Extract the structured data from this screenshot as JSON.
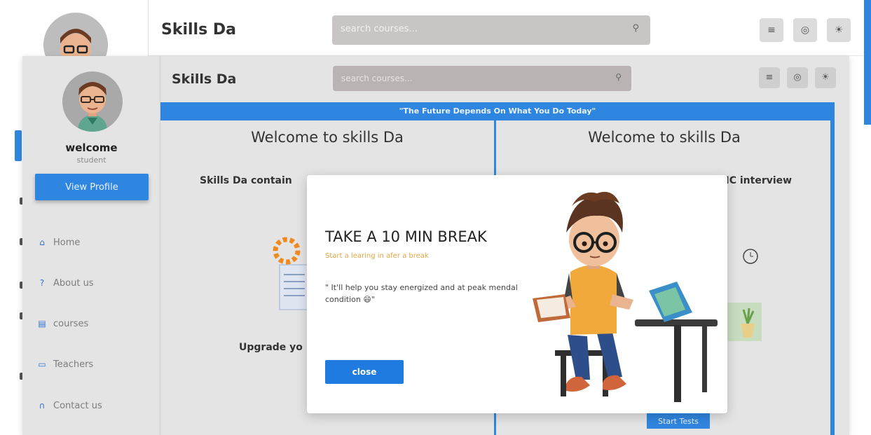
{
  "background": {
    "app_title": "Skills Da",
    "search_placeholder": "search courses...",
    "search_icon": "search-icon",
    "buttons": [
      {
        "icon": "menu-icon",
        "glyph": "≡"
      },
      {
        "icon": "settings-icon",
        "glyph": "◎"
      },
      {
        "icon": "sun-icon",
        "glyph": "☀"
      }
    ]
  },
  "header": {
    "app_title": "Skills Da",
    "search_placeholder": "search courses...",
    "search_icon": "search-icon",
    "buttons": [
      {
        "icon": "menu-icon",
        "glyph": "≡"
      },
      {
        "icon": "settings-icon",
        "glyph": "◎"
      },
      {
        "icon": "sun-icon",
        "glyph": "☀"
      }
    ]
  },
  "sidebar": {
    "welcome": "welcome",
    "role": "student",
    "view_profile": "View Profile",
    "items": [
      {
        "label": "Home",
        "icon": "home-icon"
      },
      {
        "label": "About us",
        "icon": "question-icon"
      },
      {
        "label": "courses",
        "icon": "courses-icon"
      },
      {
        "label": "Teachers",
        "icon": "monitor-icon"
      },
      {
        "label": "Contact us",
        "icon": "headset-icon"
      }
    ]
  },
  "quote_bar": "\"The Future Depends On What You Do Today\"",
  "left_card": {
    "title": "Welcome to skills Da",
    "description": "Skills Da contain",
    "footer": "Upgrade yo"
  },
  "right_card": {
    "title": "Welcome to skills Da",
    "description": "NC interview",
    "button": "Start Tests"
  },
  "modal": {
    "title": "TAKE A 10 MIN BREAK",
    "subtitle": "Start a learing in afer a break",
    "quote": "\" It'll help you stay energized and at peak mendal condition 😄\"",
    "close_button": "close"
  },
  "colors": {
    "accent": "#2f86e0",
    "panel": "#e4e4e4",
    "search": "#b9b3b3",
    "subtitle": "#e0a646"
  }
}
